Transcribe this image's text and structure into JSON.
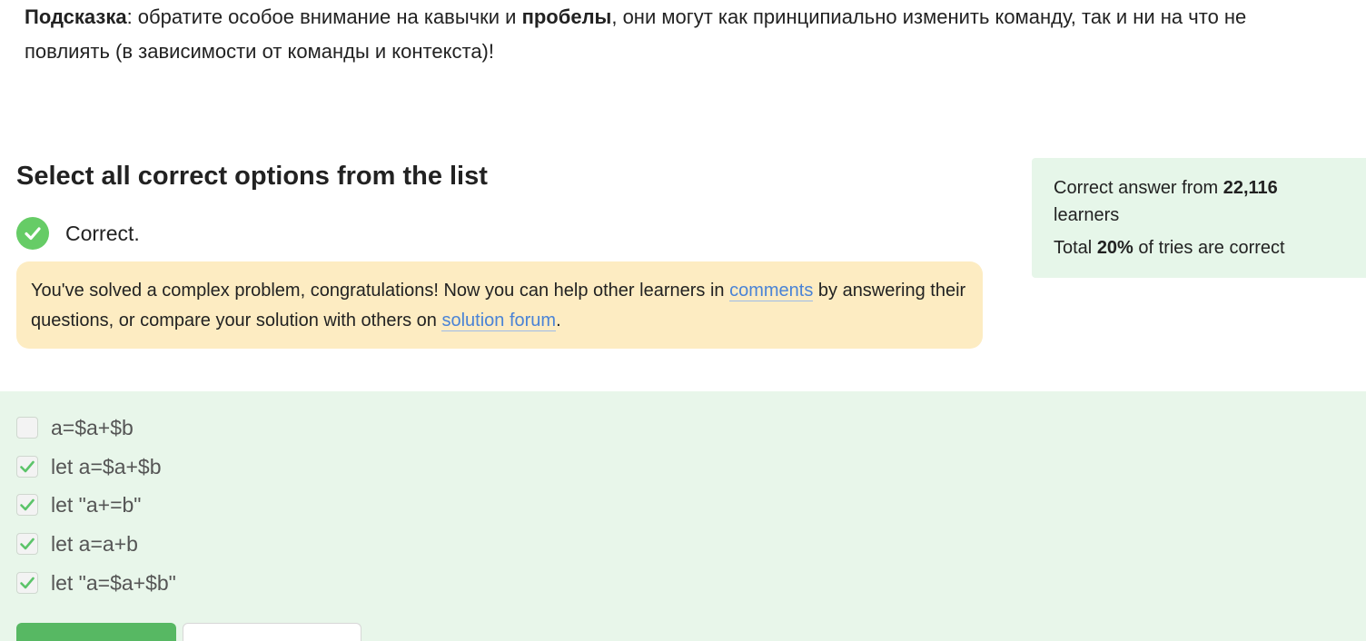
{
  "hint": {
    "label": "Подсказка",
    "text_a": ": обратите особое внимание на кавычки и ",
    "emphasis": "пробелы",
    "text_b": ", они могут как принципиально изменить команду, так и ни на что не повлиять (в зависимости от команды и контекста)!"
  },
  "quiz": {
    "title": "Select all correct options from the list",
    "status": "Correct.",
    "status_icon": "check-circle-icon"
  },
  "congrats": {
    "text_a": "You've solved a complex problem, congratulations! Now you can help other learners in ",
    "link_comments": "comments",
    "text_b": " by answering their questions, or compare your solution with others on ",
    "link_forum": "solution forum",
    "text_c": "."
  },
  "stats": {
    "line1_a": "Correct answer from ",
    "learners_count": "22,116",
    "line1_b": "learners",
    "line2_a": "Total ",
    "percent": "20%",
    "line2_b": " of tries are correct"
  },
  "options": [
    {
      "label": "a=$a+$b",
      "checked": false
    },
    {
      "label": "let a=$a+$b",
      "checked": true
    },
    {
      "label": "let \"a+=b\"",
      "checked": true
    },
    {
      "label": "let a=a+b",
      "checked": true
    },
    {
      "label": "let \"a=$a+$b\"",
      "checked": true
    }
  ],
  "colors": {
    "success": "#66cc66",
    "check_mark": "#5cc46a",
    "congrats_bg": "#fdecc2",
    "stats_bg": "#e6f6e9",
    "options_bg": "#e8f6ea",
    "link": "#4a83d6",
    "primary_button": "#57b863"
  }
}
